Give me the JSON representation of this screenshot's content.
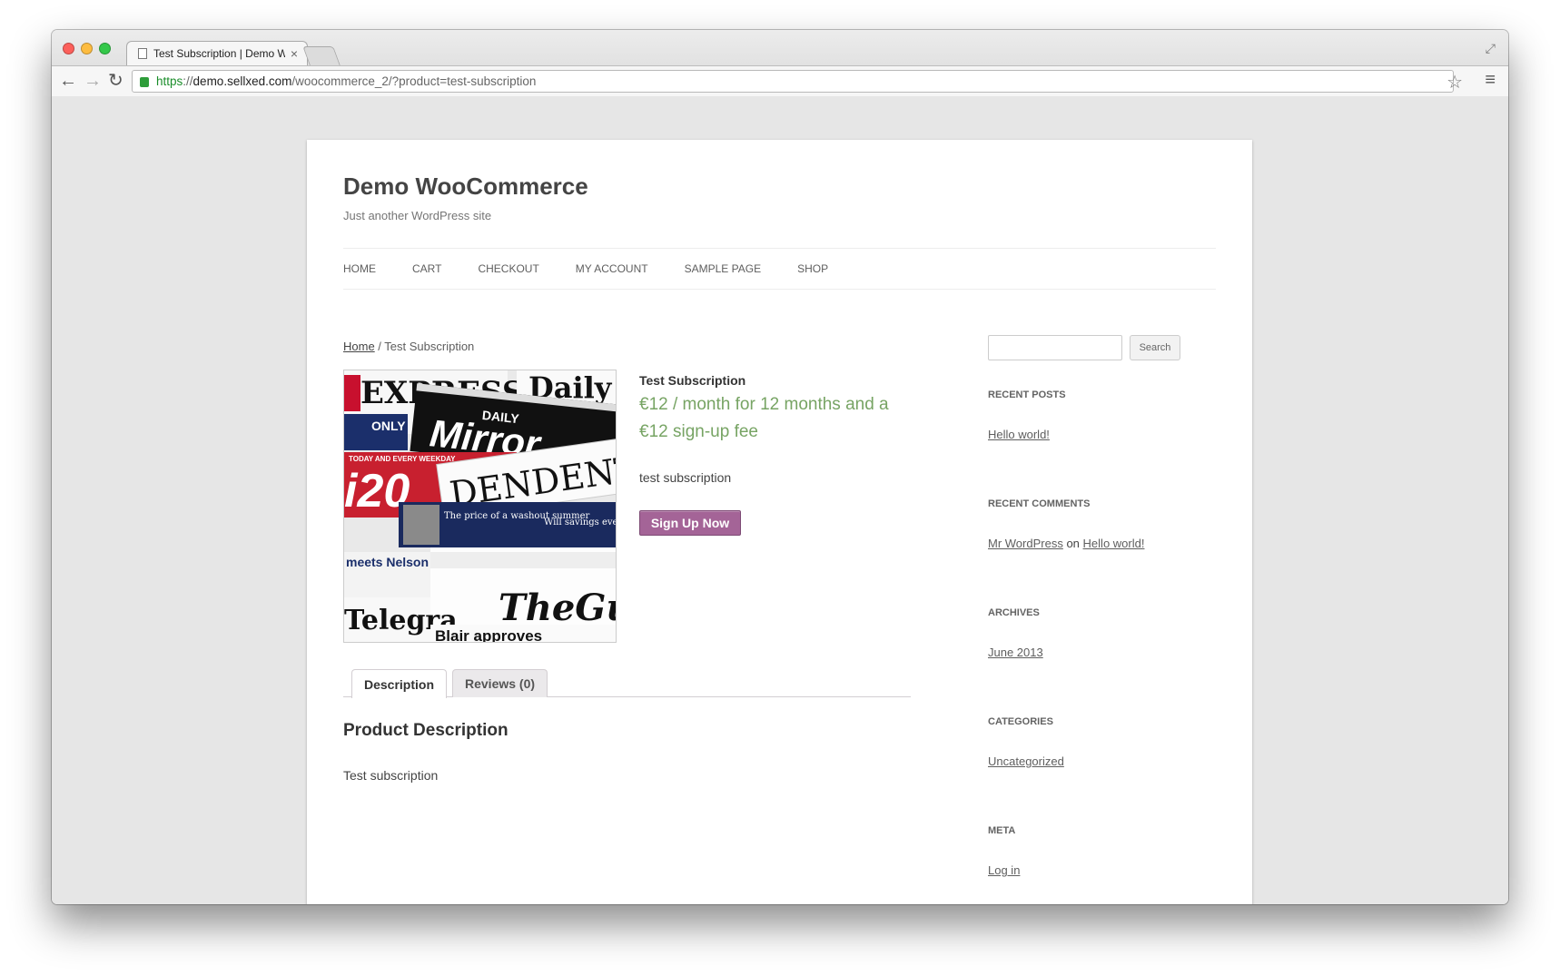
{
  "browser": {
    "tab_title": "Test Subscription | Demo WooCommerce",
    "tab_close": "×",
    "url_scheme": "https",
    "url_separator": "://",
    "url_host": "demo.sellxed.com",
    "url_path": "/woocommerce_2/?product=test-subscription",
    "icons": [
      "back-arrow-icon",
      "forward-arrow-icon",
      "reload-icon",
      "lock-icon",
      "star-icon",
      "menu-icon",
      "fullscreen-icon"
    ]
  },
  "site": {
    "title": "Demo WooCommerce",
    "tagline": "Just another WordPress site",
    "nav": [
      "HOME",
      "CART",
      "CHECKOUT",
      "MY ACCOUNT",
      "SAMPLE PAGE",
      "SHOP"
    ]
  },
  "breadcrumb": {
    "home": "Home",
    "separator": " / ",
    "current": "Test Subscription"
  },
  "product": {
    "title": "Test Subscription",
    "price": "€12 / month for 12 months and a €12 sign-up fee",
    "short_description": "test subscription",
    "button_label": "Sign Up Now",
    "image_texts": {
      "express": "EXPRESS",
      "daily": "Daily",
      "mirror_label": "DAILY",
      "mirror": "Mirror",
      "only": "ONLY",
      "i20": "i20",
      "independent": "DENDENT",
      "today": "TODAY AND EVERY WEEKDAY",
      "price_of": "The price of a washout summer",
      "savings": "Will savings ever be safe?",
      "nelson": "meets Nelson",
      "guardian": "TheGua",
      "telegraph": "Telegra",
      "blair": "Blair approves"
    }
  },
  "tabs": [
    {
      "label": "Description"
    },
    {
      "label": "Reviews (0)"
    }
  ],
  "description": {
    "heading": "Product Description",
    "body": "Test subscription"
  },
  "sidebar": {
    "search_button": "Search",
    "recent_posts_title": "RECENT POSTS",
    "recent_post": "Hello world!",
    "recent_comments_title": "RECENT COMMENTS",
    "comment_author": "Mr WordPress",
    "comment_on": "on",
    "comment_post": "Hello world!",
    "archives_title": "ARCHIVES",
    "archive_item": "June 2013",
    "categories_title": "CATEGORIES",
    "category_item": "Uncategorized",
    "meta_title": "META",
    "meta_item": "Log in"
  },
  "colors": {
    "price": "#77a464",
    "button": "#a46497",
    "page_bg": "#e6e6e6"
  }
}
